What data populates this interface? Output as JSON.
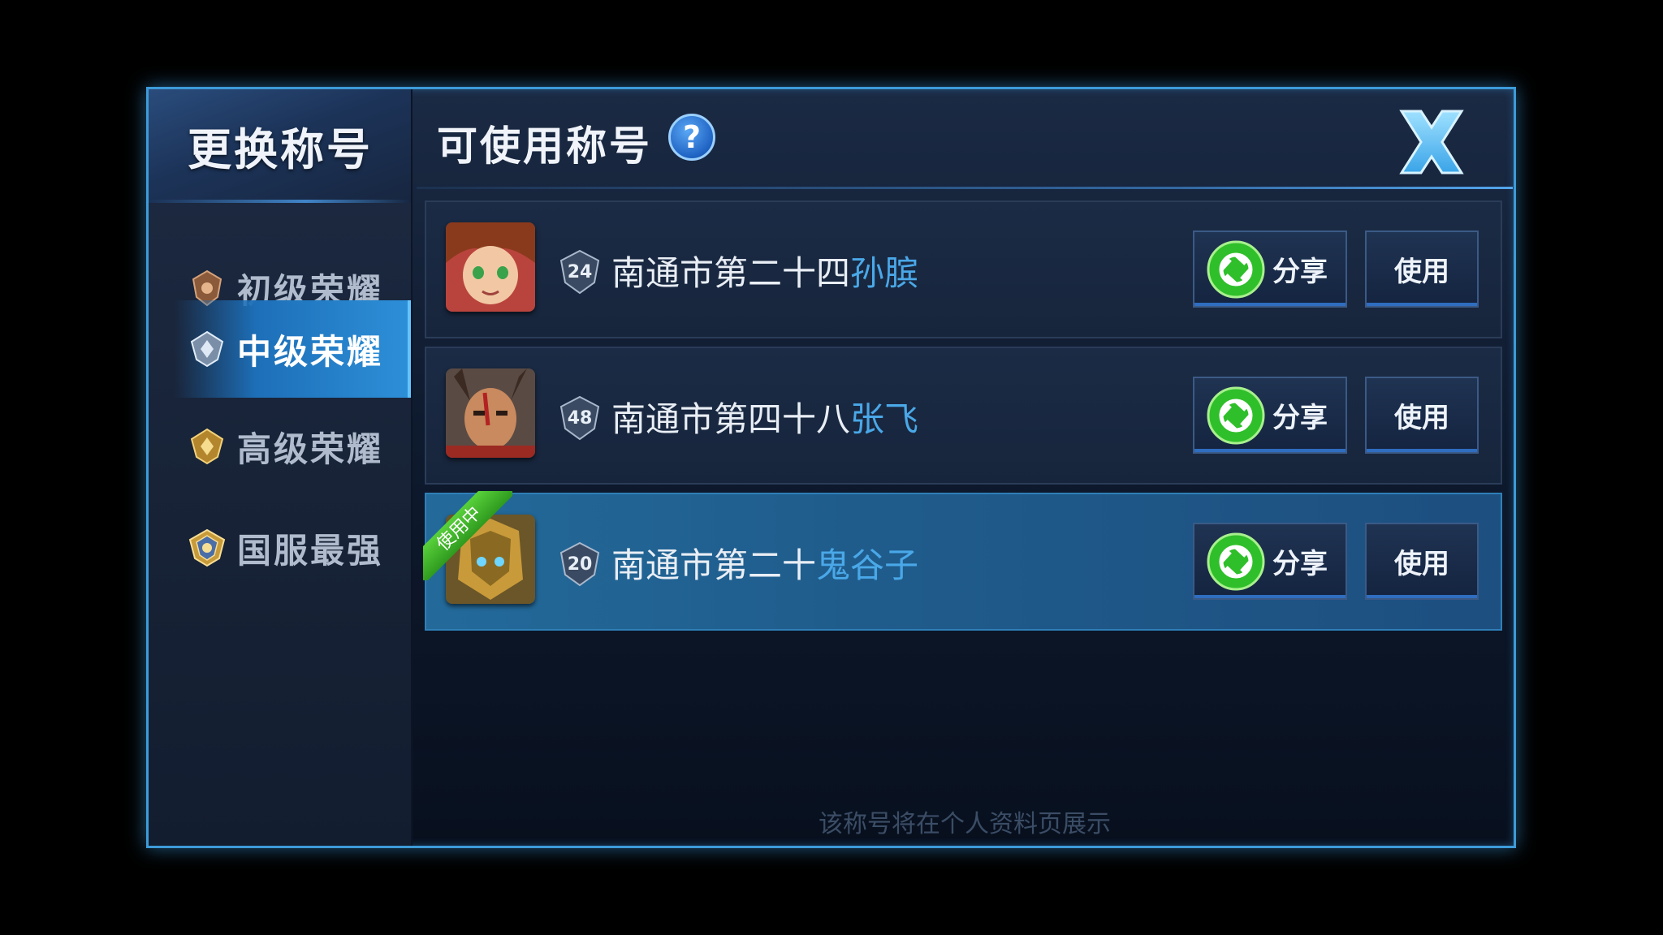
{
  "sidebar": {
    "title": "更换称号",
    "items": [
      {
        "label": "初级荣耀",
        "active": false
      },
      {
        "label": "中级荣耀",
        "active": true
      },
      {
        "label": "高级荣耀",
        "active": false
      },
      {
        "label": "国服最强",
        "active": false
      }
    ]
  },
  "header": {
    "title": "可使用称号",
    "help_label": "?"
  },
  "rows": [
    {
      "rank": "24",
      "title_prefix": "南通市第二十四",
      "hero": "孙膑",
      "share_label": "分享",
      "use_label": "使用",
      "in_use": false
    },
    {
      "rank": "48",
      "title_prefix": "南通市第四十八",
      "hero": "张飞",
      "share_label": "分享",
      "use_label": "使用",
      "in_use": false
    },
    {
      "rank": "20",
      "title_prefix": "南通市第二十",
      "hero": "鬼谷子",
      "share_label": "分享",
      "use_label": "使用",
      "in_use": true,
      "in_use_label": "使用中"
    }
  ],
  "footer_note": "该称号将在个人资料页展示",
  "colors": {
    "accent": "#3d9bd8",
    "hero_name": "#4aa8e8",
    "active_tab": "#2d8fd8",
    "in_use_ribbon": "#3fb32a"
  }
}
